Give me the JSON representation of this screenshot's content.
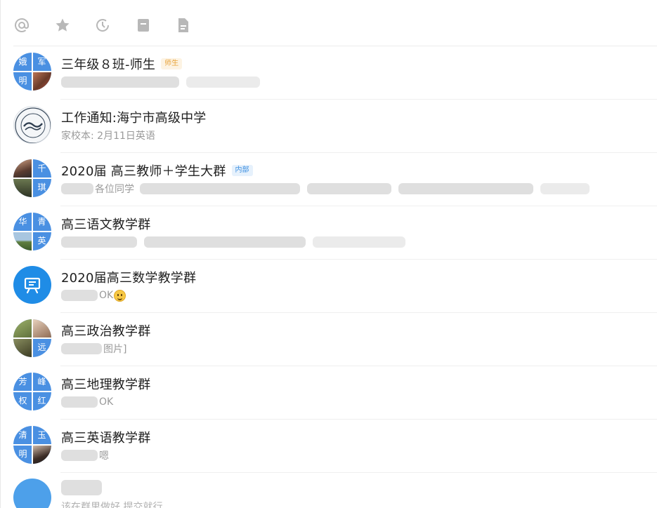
{
  "toolbar": {
    "icons": [
      "at-icon",
      "star-icon",
      "clock-icon",
      "archive-icon",
      "document-icon"
    ]
  },
  "conversations": [
    {
      "title": "三年级８班-师生",
      "tag": "师生",
      "avatar_chars": [
        "娥",
        "军",
        "明",
        ""
      ],
      "preview": ""
    },
    {
      "title": "工作通知:海宁市高级中学",
      "tag": "",
      "preview": "家校本: 2月11日英语"
    },
    {
      "title": "2020届 高三教师＋学生大群",
      "tag": "内部",
      "avatar_chars": [
        "",
        "千",
        "",
        "琪"
      ],
      "preview": "各位同学"
    },
    {
      "title": "高三语文教学群",
      "tag": "",
      "avatar_chars": [
        "华",
        "青",
        "",
        "英"
      ],
      "preview": ""
    },
    {
      "title": "2020届高三数学教学群",
      "tag": "",
      "preview": "OK"
    },
    {
      "title": "高三政治教学群",
      "tag": "",
      "avatar_chars": [
        "",
        "",
        "",
        "远"
      ],
      "preview": "图片]"
    },
    {
      "title": "高三地理教学群",
      "tag": "",
      "avatar_chars": [
        "芳",
        "峰",
        "权",
        "红"
      ],
      "preview": "OK"
    },
    {
      "title": "高三英语教学群",
      "tag": "",
      "avatar_chars": [
        "清",
        "玉",
        "明",
        ""
      ],
      "preview": "嗯"
    }
  ],
  "partial_row": {
    "preview": "该在群里做好 提交就行"
  },
  "colors": {
    "accent_blue": "#4a90e2",
    "app_blue": "#1f8ce6",
    "tag_orange": "#e8a33a",
    "tag_blue": "#3d8fe0"
  }
}
